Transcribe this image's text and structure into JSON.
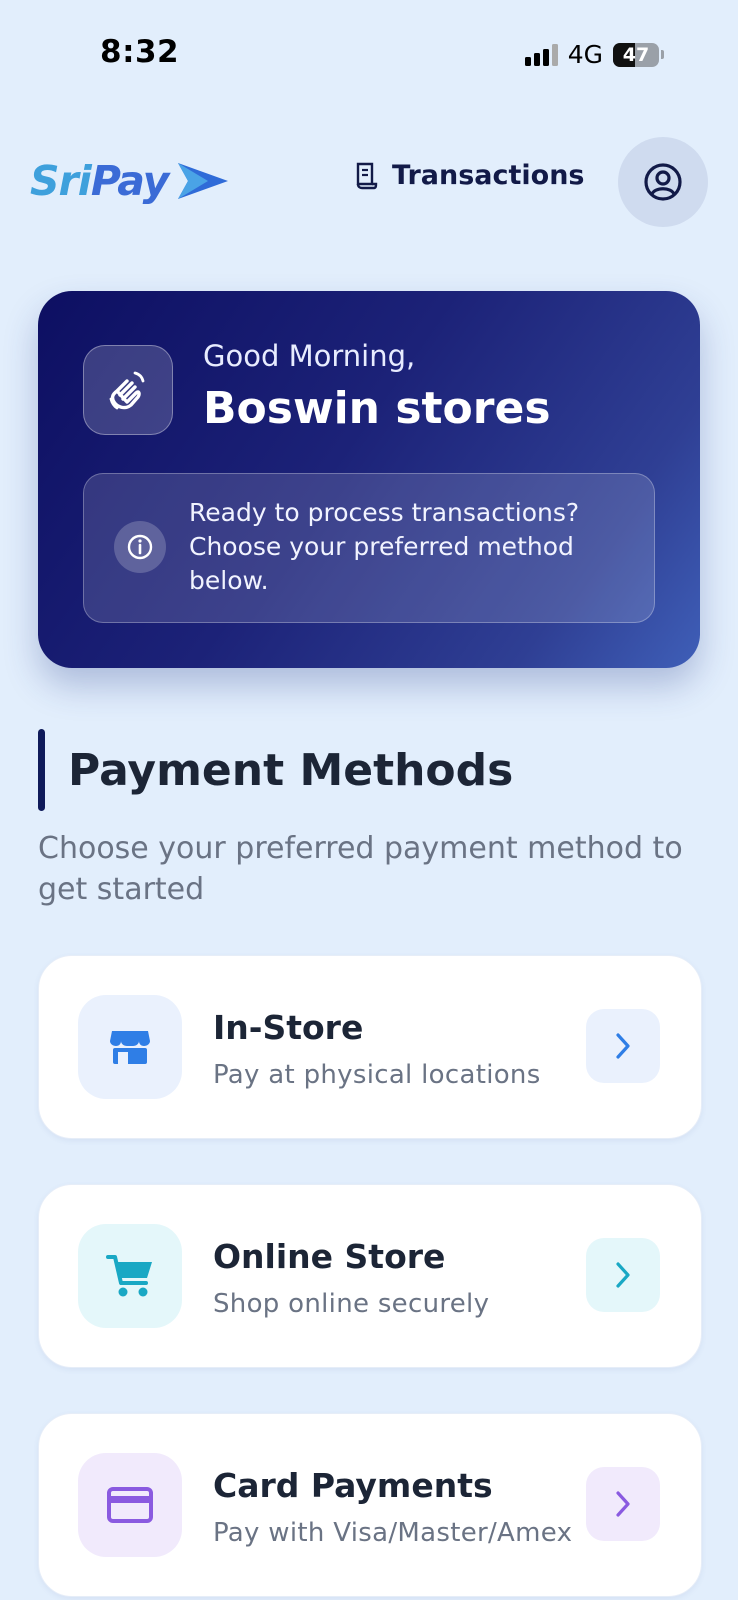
{
  "status_bar": {
    "time": "8:32",
    "network": "4G",
    "battery": "47"
  },
  "header": {
    "logo_part1": "Sri",
    "logo_part2": "Pay",
    "transactions_label": "Transactions"
  },
  "greeting": {
    "salutation": "Good Morning,",
    "store_name": "Boswin stores",
    "info_text": "Ready to process transactions? Choose your preferred method below."
  },
  "payment_methods": {
    "title": "Payment Methods",
    "description": "Choose your preferred payment method to get started",
    "items": [
      {
        "title": "In-Store",
        "subtitle": "Pay at physical locations",
        "icon": "store-icon",
        "accent": "#2f7ee6",
        "icon_bg": "#eaf1fd"
      },
      {
        "title": "Online Store",
        "subtitle": "Shop online securely",
        "icon": "cart-icon",
        "accent": "#19a8c4",
        "icon_bg": "#e4f7fa"
      },
      {
        "title": "Card Payments",
        "subtitle": "Pay with Visa/Master/Amex",
        "icon": "credit-card-icon",
        "accent": "#8a5ae0",
        "icon_bg": "#f1eafc"
      }
    ]
  }
}
